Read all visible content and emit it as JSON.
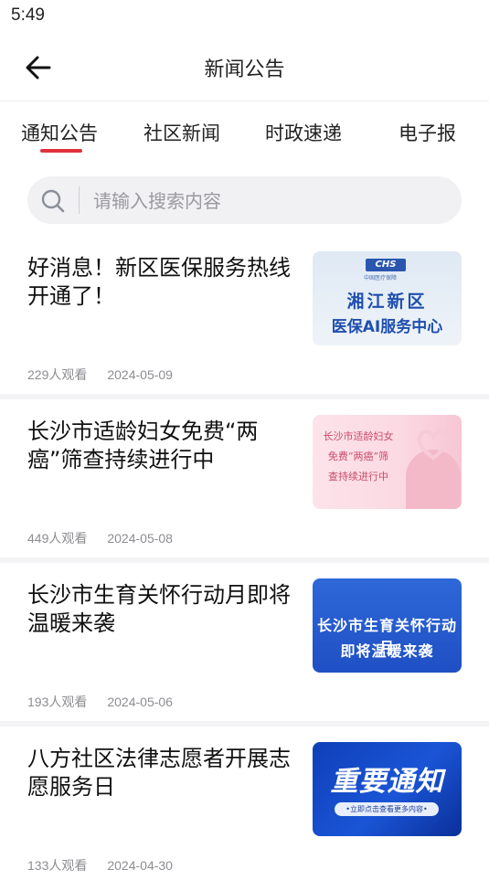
{
  "status_bar": {
    "time": "5:49"
  },
  "header": {
    "title": "新闻公告",
    "back_icon": "arrow-left-icon"
  },
  "tabs": [
    {
      "label": "通知公告",
      "active": true
    },
    {
      "label": "社区新闻",
      "active": false
    },
    {
      "label": "时政速递",
      "active": false
    },
    {
      "label": "电子报",
      "active": false
    }
  ],
  "search": {
    "placeholder": "请输入搜索内容",
    "value": "",
    "icon": "search-icon"
  },
  "news": [
    {
      "title": "好消息！新区医保服务热线开通了！",
      "views": "229人观看",
      "date": "2024-05-09",
      "thumb": {
        "logo": "CHS",
        "logo_sub": "中国医疗保障",
        "line1": "湘江新区",
        "line2": "医保AI服务中心"
      }
    },
    {
      "title": "长沙市适龄妇女免费“两癌”筛查持续进行中",
      "views": "449人观看",
      "date": "2024-05-08",
      "thumb": {
        "line1": "长沙市适龄妇女",
        "line2": "免费“两癌”筛",
        "line3": "查持续进行中"
      }
    },
    {
      "title": "长沙市生育关怀行动月即将温暖来袭",
      "views": "193人观看",
      "date": "2024-05-06",
      "thumb": {
        "line1": "长沙市生育关怀行动月",
        "line2": "即将温暖来袭"
      }
    },
    {
      "title": "八方社区法律志愿者开展志愿服务日",
      "views": "133人观看",
      "date": "2024-04-30",
      "thumb": {
        "big": "重要通知",
        "pill": "•立即点击查看更多内容•"
      }
    }
  ],
  "colors": {
    "accent": "#e0323d",
    "thumb_blue": "#1f4fc4",
    "thumb_pink": "#fbd9e2"
  }
}
